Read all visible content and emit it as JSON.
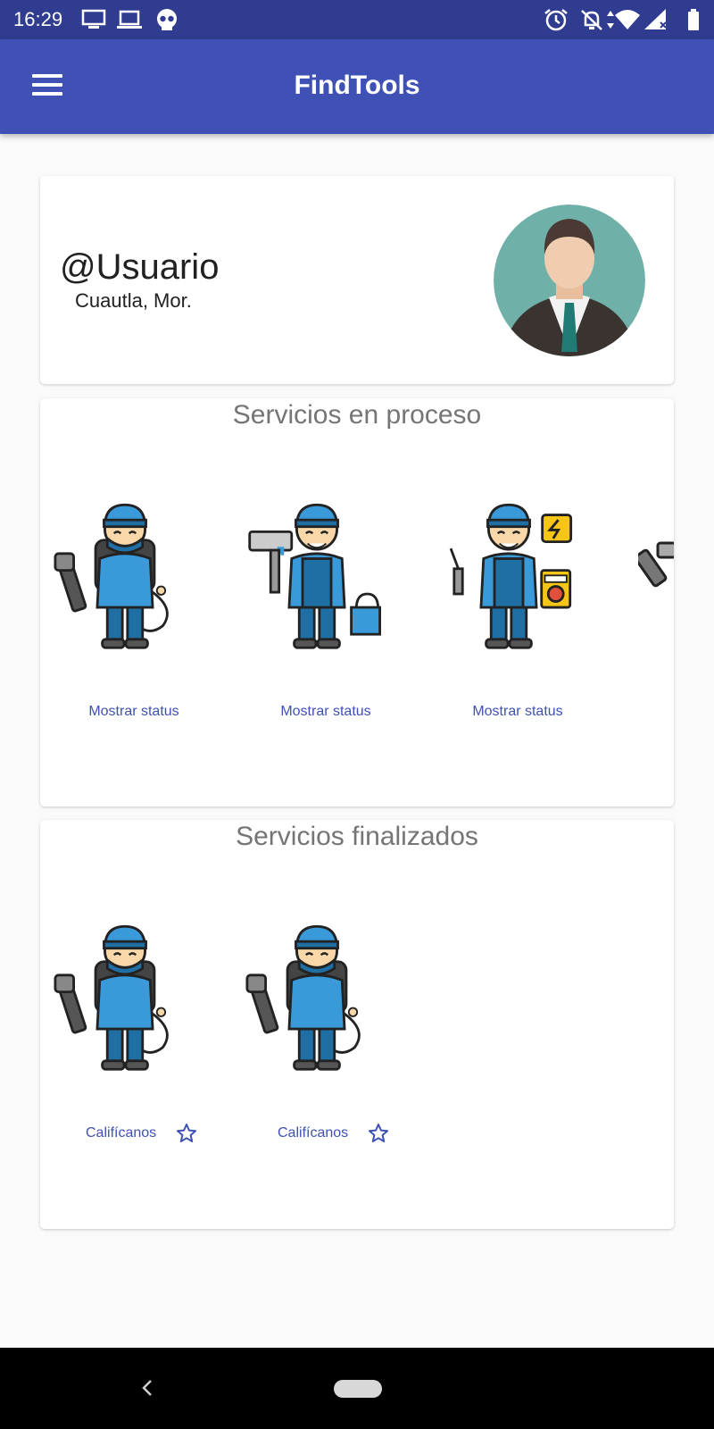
{
  "status_bar": {
    "time": "16:29",
    "left_icons": [
      "monitor-icon",
      "laptop-icon",
      "skull-icon"
    ],
    "right_icons": [
      "alarm-icon",
      "notifications-off-icon",
      "wifi-icon",
      "signal-icon",
      "battery-icon"
    ]
  },
  "app_bar": {
    "title": "FindTools",
    "menu_icon": "hamburger-menu-icon",
    "color": "#3f51b5",
    "status_color": "#2f3c8f"
  },
  "profile": {
    "username": "@Usuario",
    "location": "Cuautla, Mor.",
    "avatar_icon": "businessman-avatar-icon"
  },
  "in_process": {
    "title": "Servicios en proceso",
    "items": [
      {
        "icon": "cleaning-worker-icon",
        "action": "Mostrar status"
      },
      {
        "icon": "painter-worker-icon",
        "action": "Mostrar status"
      },
      {
        "icon": "electrician-worker-icon",
        "action": "Mostrar status"
      }
    ]
  },
  "finished": {
    "title": "Servicios finalizados",
    "items": [
      {
        "icon": "cleaning-worker-icon",
        "action": "Califícanos",
        "action_icon": "star-outline-icon"
      },
      {
        "icon": "cleaning-worker-icon",
        "action": "Califícanos",
        "action_icon": "star-outline-icon"
      }
    ]
  },
  "nav": {
    "back_icon": "back-chevron-icon",
    "home_icon": "home-pill-icon"
  },
  "colors": {
    "accent": "#3f51b5",
    "worker_blue": "#3a9ad9",
    "worker_dark_blue": "#1f6fa5"
  }
}
